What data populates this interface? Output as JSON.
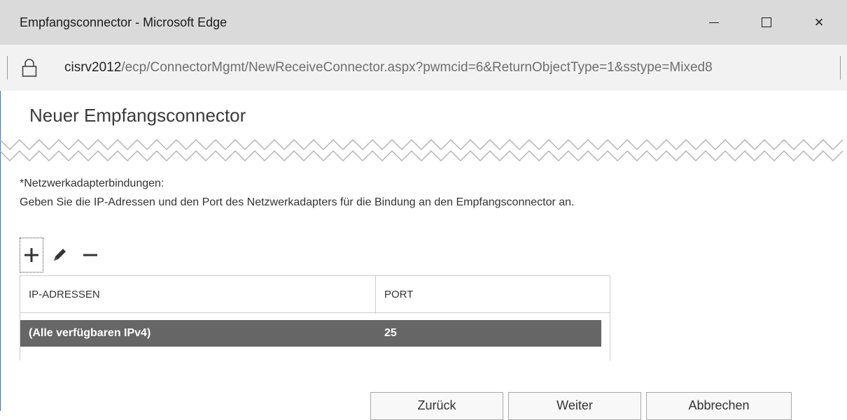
{
  "window": {
    "title": "Empfangsconnector - Microsoft Edge",
    "minimize_icon": "minimize-icon",
    "maximize_icon": "maximize-icon",
    "close_glyph": "×"
  },
  "address_bar": {
    "host": "cisrv2012",
    "path": "/ecp/ConnectorMgmt/NewReceiveConnector.aspx?pwmcid=6&ReturnObjectType=1&sstype=Mixed8",
    "icon": "lock-icon"
  },
  "page": {
    "title": "Neuer Empfangsconnector",
    "field_label": "*Netzwerkadapterbindungen:",
    "description": "Geben Sie die IP-Adressen und den Port des Netzwerkadapters für die Bindung an den Empfangsconnector an."
  },
  "toolbar": {
    "add_icon": "plus-icon",
    "edit_icon": "pencil-icon",
    "remove_icon": "minus-icon"
  },
  "table": {
    "columns": [
      "IP-ADRESSEN",
      "PORT"
    ],
    "rows": [
      [
        "(Alle verfügbaren IPv4)",
        "25"
      ]
    ],
    "selected_row_color": "#666666"
  },
  "footer": {
    "back_label": "Zurück",
    "next_label": "Weiter",
    "cancel_label": "Abbrechen"
  }
}
